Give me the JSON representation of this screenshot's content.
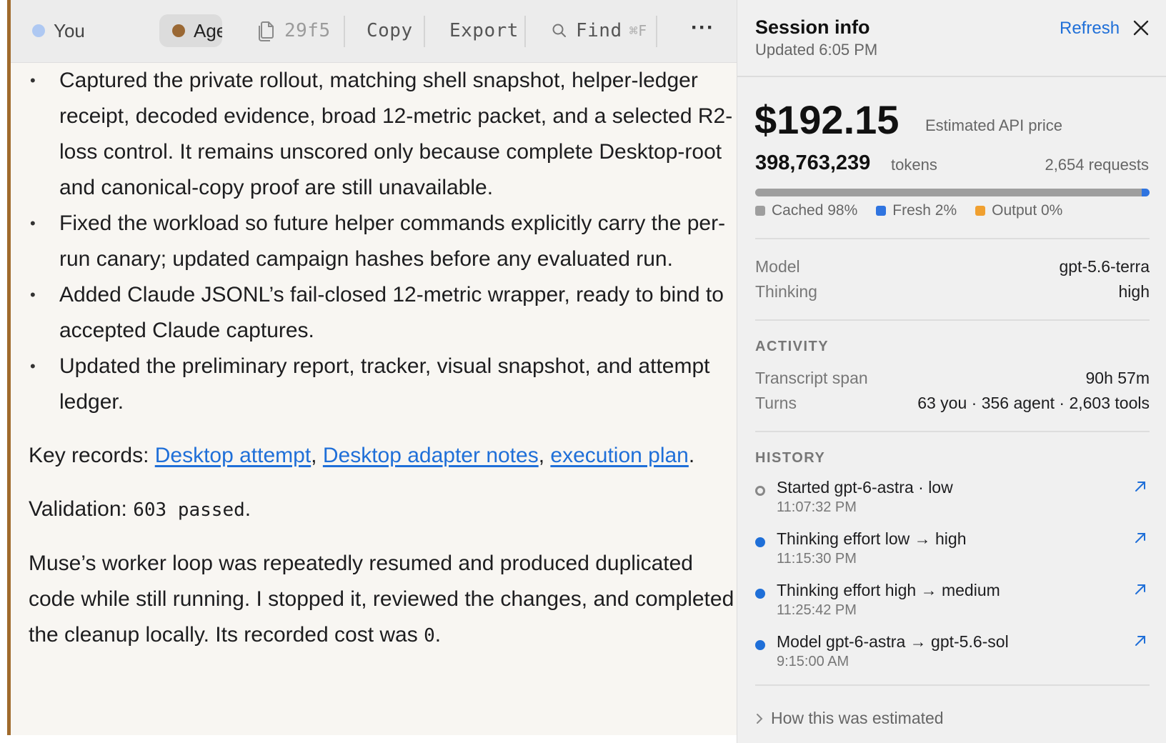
{
  "toolbar": {
    "you_label": "You",
    "you_dot_color": "#aec8f2",
    "agent_label": "Agent",
    "agent_dot_color": "#9a6834",
    "file_label": "29f5",
    "copy_label": "Copy",
    "export_label": "Export",
    "find_label": "Find",
    "find_shortcut": "⌘F",
    "more_label": "···"
  },
  "content": {
    "bullets": [
      "Captured the private rollout, matching shell snapshot, helper-ledger receipt, decoded evidence, broad 12-metric packet, and a selected R2-loss control. It remains unscored only because complete Desktop-root and canonical-copy proof are still unavailable.",
      "Fixed the workload so future helper commands explicitly carry the per-run canary; updated campaign hashes before any evaluated run.",
      "Added Claude JSONL’s fail-closed 12-metric wrapper, ready to bind to accepted Claude captures.",
      "Updated the preliminary report, tracker, visual snapshot, and attempt ledger."
    ],
    "key_records_prefix": "Key records: ",
    "links": [
      "Desktop attempt",
      "Desktop adapter notes",
      "execution plan"
    ],
    "validation_prefix": "Validation: ",
    "validation_code": "603 passed",
    "muse_text": "Muse’s worker loop was repeatedly resumed and produced duplicated code while still running. I stopped it, reviewed the changes, and completed the cleanup locally. Its recorded cost was ",
    "muse_cost": "0"
  },
  "panel": {
    "title": "Session info",
    "updated": "Updated 6:05 PM",
    "refresh_label": "Refresh",
    "price": "$192.15",
    "price_label": "Estimated API price",
    "tokens": "398,763,239",
    "tokens_label": "tokens",
    "requests": "2,654 requests",
    "usage": [
      {
        "label": "Cached 98%",
        "fraction": 0.98,
        "color": "#9e9e9e"
      },
      {
        "label": "Fresh 2%",
        "fraction": 0.02,
        "color": "#2f74e0"
      },
      {
        "label": "Output 0%",
        "fraction": 0.0,
        "color": "#f0a030"
      }
    ],
    "model_label": "Model",
    "model_value": "gpt-5.6-terra",
    "thinking_label": "Thinking",
    "thinking_value": "high",
    "activity_heading": "ACTIVITY",
    "span_label": "Transcript span",
    "span_value": "90h 57m",
    "turns_label": "Turns",
    "turns_value": "63 you · 356 agent · 2,603 tools",
    "history_heading": "HISTORY",
    "history": [
      {
        "text": "Started gpt-6-astra · low",
        "time": "11:07:32 PM",
        "dot": "hollow"
      },
      {
        "text": "Thinking effort low → high",
        "time": "11:15:30 PM",
        "dot": "filled"
      },
      {
        "text": "Thinking effort high → medium",
        "time": "11:25:42 PM",
        "dot": "filled"
      },
      {
        "text": "Model gpt-6-astra → gpt-5.6-sol",
        "time": "9:15:00 AM",
        "dot": "filled"
      }
    ],
    "estimated_label": "How this was estimated"
  }
}
